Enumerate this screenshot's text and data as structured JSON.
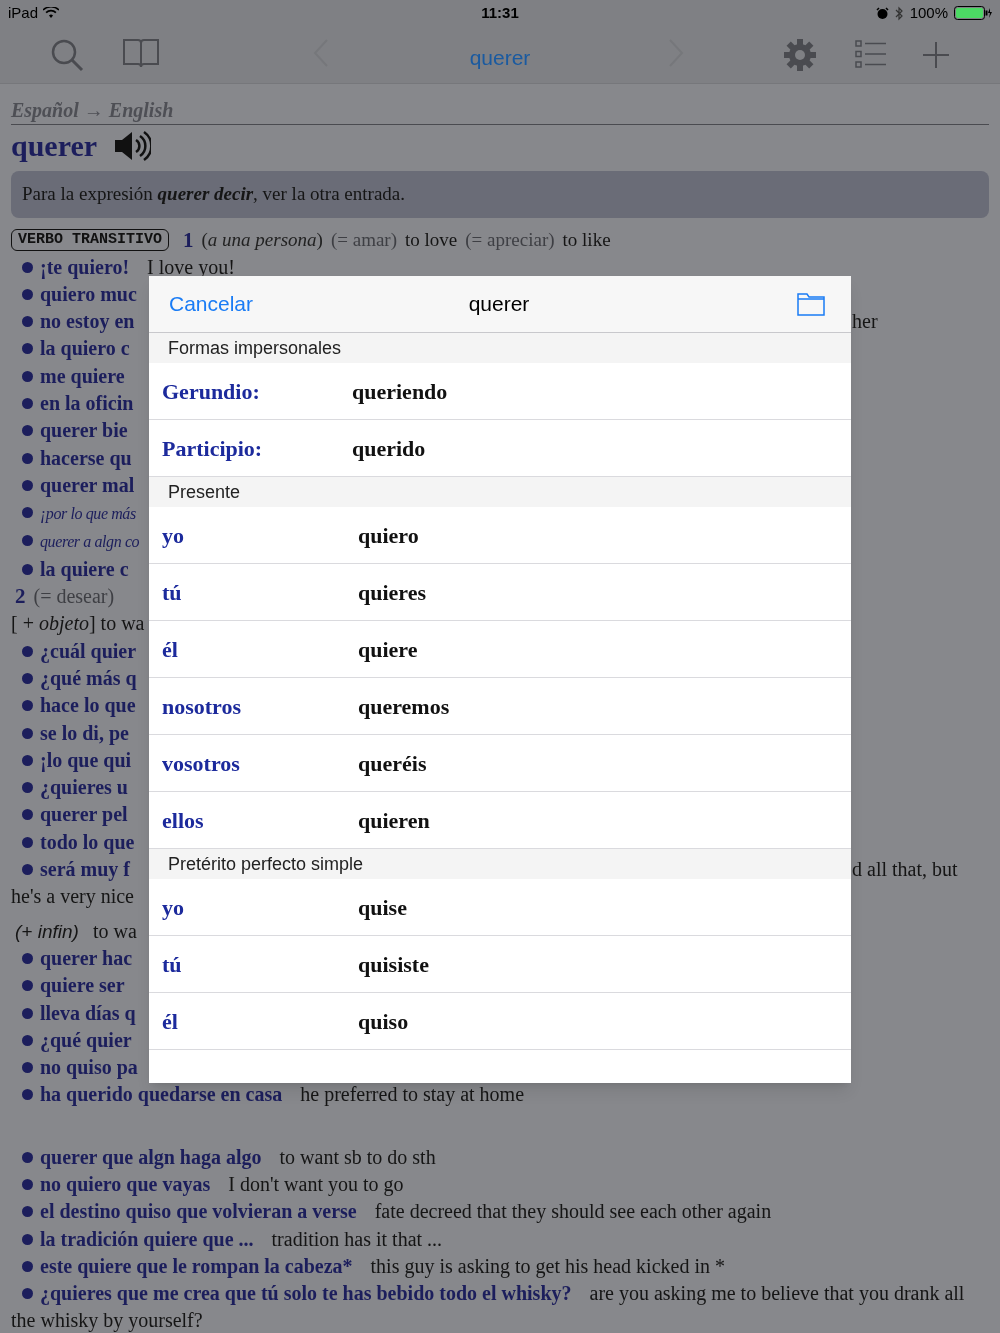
{
  "status_bar": {
    "device": "iPad",
    "time": "11:31",
    "battery": "100%"
  },
  "toolbar": {
    "title": "querer",
    "back_disabled": true,
    "forward_disabled": true
  },
  "entry": {
    "direction": "Español → English",
    "headword": "querer",
    "note": "Para la expresión **querer decir**, ver la otra entrada.",
    "grammar": {
      "badge": "VERBO TRANSITIVO",
      "number": "1",
      "context": "(*a una persona*)",
      "synonym": "(= amar)",
      "translation": "to love",
      "synonym_2": "(= apreciar)",
      "translation_2": "to like"
    },
    "lines": [
      {
        "kind": "example",
        "phrase": "¡te quiero!",
        "translation": "I love you!"
      },
      {
        "kind": "example",
        "phrase": "quiero muc"
      },
      {
        "kind": "example",
        "phrase": "no estoy en",
        "tail": "her"
      },
      {
        "kind": "example",
        "phrase": "la quiero c"
      },
      {
        "kind": "example",
        "phrase": "me quiere"
      },
      {
        "kind": "example",
        "phrase": "en la oficin"
      },
      {
        "kind": "example",
        "phrase": "querer bie"
      },
      {
        "kind": "example",
        "phrase": "hacerse qu"
      },
      {
        "kind": "example",
        "phrase": "querer mal"
      },
      {
        "kind": "italic_example",
        "phrase": "¡por lo que más"
      },
      {
        "kind": "italic_example",
        "phrase": "querer a algn co"
      },
      {
        "kind": "example",
        "phrase": "la quiere c"
      },
      {
        "kind": "sense",
        "number": "2",
        "text": "(= desear)"
      },
      {
        "kind": "plain",
        "text": "[ + *objeto*]  to wa"
      },
      {
        "kind": "example",
        "phrase": "¿cuál quier"
      },
      {
        "kind": "example",
        "phrase": "¿qué más q"
      },
      {
        "kind": "example",
        "phrase": "hace lo que"
      },
      {
        "kind": "example",
        "phrase": "se lo di, pe"
      },
      {
        "kind": "example",
        "phrase": "¡lo que qui"
      },
      {
        "kind": "example",
        "phrase": "¿quieres u"
      },
      {
        "kind": "example",
        "phrase": "querer pel"
      },
      {
        "kind": "example",
        "phrase": "todo lo que"
      },
      {
        "kind": "example",
        "phrase": "será muy f",
        "tail": "d all that, but"
      },
      {
        "kind": "plain",
        "text": "he's a very nice"
      },
      {
        "kind": "label",
        "label": "(+ infin)",
        "text": "to wa"
      },
      {
        "kind": "example",
        "phrase": "querer hac"
      },
      {
        "kind": "example",
        "phrase": "quiere ser"
      },
      {
        "kind": "example",
        "phrase": "lleva días q"
      },
      {
        "kind": "example",
        "phrase": "¿qué quier"
      },
      {
        "kind": "example",
        "phrase": "no quiso pa"
      },
      {
        "kind": "example",
        "phrase": "ha querido quedarse en casa",
        "translation": "he preferred to stay at home"
      }
    ],
    "lines_2": [
      {
        "kind": "example",
        "phrase": "querer que algn haga algo",
        "translation": "to want sb to do sth"
      },
      {
        "kind": "example",
        "phrase": "no quiero que vayas",
        "translation": "I don't want you to go"
      },
      {
        "kind": "example",
        "phrase": "el destino quiso que volvieran a verse",
        "translation": "fate decreed that they should see each other again"
      },
      {
        "kind": "example",
        "phrase": "la tradición quiere que ...",
        "translation": "tradition has it that ..."
      },
      {
        "kind": "example",
        "phrase": "este quiere que le rompan la cabeza*",
        "translation": "this guy is asking to get his head kicked in *"
      },
      {
        "kind": "example",
        "phrase": "¿quieres que me crea que tú solo te has bebido todo el whisky?",
        "translation": "are you asking me to believe that you drank all the whisky by yourself?"
      }
    ]
  },
  "sheet": {
    "cancel": "Cancelar",
    "title": "querer",
    "sections": [
      {
        "title": "Formas impersonales",
        "kind": "impersonal",
        "rows": [
          {
            "label": "Gerundio:",
            "value": "queriendo"
          },
          {
            "label": "Participio:",
            "value": "querido"
          }
        ]
      },
      {
        "title": "Presente",
        "kind": "person",
        "rows": [
          {
            "label": "yo",
            "value": "quiero"
          },
          {
            "label": "tú",
            "value": "quieres"
          },
          {
            "label": "él",
            "value": "quiere"
          },
          {
            "label": "nosotros",
            "value": "queremos"
          },
          {
            "label": "vosotros",
            "value": "queréis"
          },
          {
            "label": "ellos",
            "value": "quieren"
          }
        ]
      },
      {
        "title": "Pretérito perfecto simple",
        "kind": "person",
        "rows": [
          {
            "label": "yo",
            "value": "quise"
          },
          {
            "label": "tú",
            "value": "quisiste"
          },
          {
            "label": "él",
            "value": "quiso"
          }
        ]
      }
    ]
  }
}
